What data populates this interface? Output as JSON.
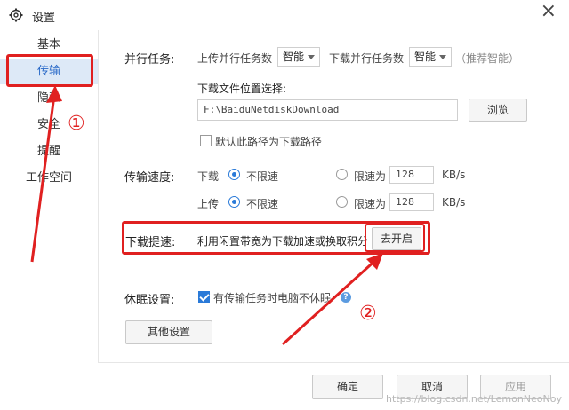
{
  "window": {
    "title": "设置",
    "close": "×"
  },
  "sidebar": {
    "items": [
      {
        "label": "基本"
      },
      {
        "label": "传输"
      },
      {
        "label": "隐私"
      },
      {
        "label": "安全"
      },
      {
        "label": "提醒"
      },
      {
        "label": "工作空间"
      }
    ],
    "active_index": 1
  },
  "parallel": {
    "label": "并行任务:",
    "upload_label": "上传并行任务数",
    "upload_value": "智能",
    "download_label": "下载并行任务数",
    "download_value": "智能",
    "hint": "（推荐智能）"
  },
  "download_location": {
    "label": "下载文件位置选择:",
    "path": "F:\\BaiduNetdiskDownload",
    "browse_button": "浏览",
    "default_checkbox_label": "默认此路径为下载路径",
    "default_checked": false
  },
  "speed": {
    "label": "传输速度:",
    "download": {
      "label": "下载",
      "unlimited": "不限速",
      "limit": "限速为",
      "value": "128",
      "unit": "KB/s",
      "unlimited_selected": true
    },
    "upload": {
      "label": "上传",
      "unlimited": "不限速",
      "limit": "限速为",
      "value": "128",
      "unit": "KB/s",
      "unlimited_selected": true
    }
  },
  "boost": {
    "label": "下载提速:",
    "description": "利用闲置带宽为下载加速或换取积分",
    "button": "去开启"
  },
  "sleep": {
    "label": "休眠设置:",
    "checkbox_label": "有传输任务时电脑不休眠",
    "checked": true,
    "info_icon": "?"
  },
  "other_button": "其他设置",
  "footer": {
    "ok": "确定",
    "cancel": "取消",
    "apply": "应用"
  },
  "annotations": {
    "marker1": "①",
    "marker2": "②"
  },
  "watermark": "https://blog.csdn.net/LemonNeoNoy",
  "colors": {
    "accent": "#2a7ad8",
    "annotation": "#e02020",
    "active_bg": "#dde9f7"
  }
}
